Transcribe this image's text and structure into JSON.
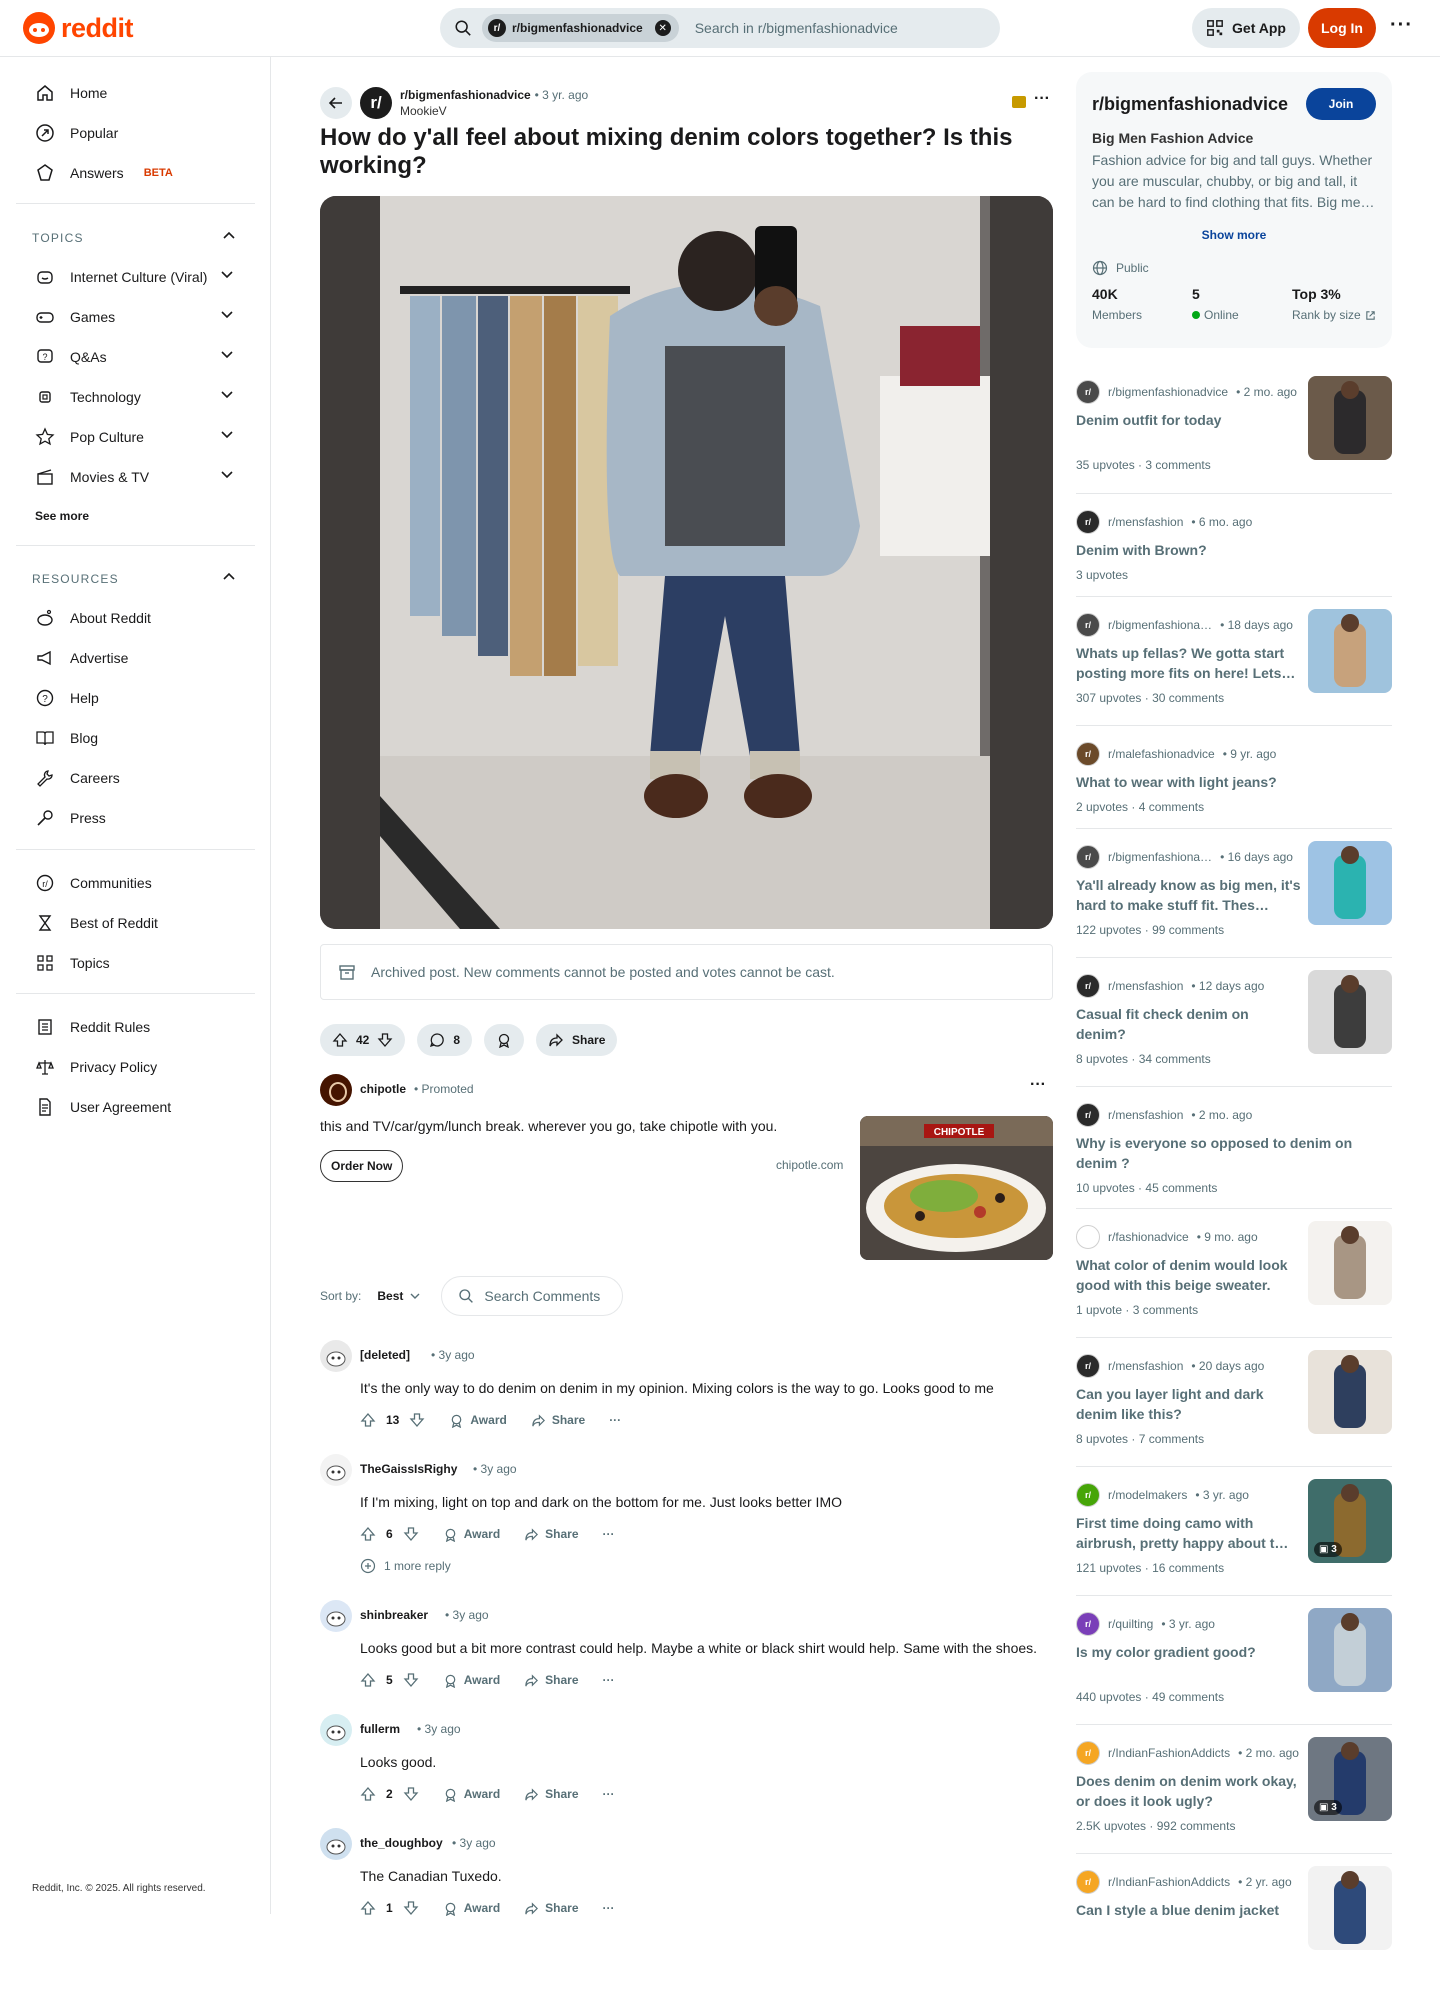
{
  "header": {
    "logo_text": "reddit",
    "search_chip": "r/bigmenfashionadvice",
    "search_placeholder": "Search in r/bigmenfashionadvice",
    "get_app": "Get App",
    "login": "Log In",
    "menu_icon": "more-dots-icon"
  },
  "leftnav": {
    "top": [
      {
        "label": "Home",
        "icon": "home-icon"
      },
      {
        "label": "Popular",
        "icon": "popular-icon"
      },
      {
        "label": "Answers",
        "icon": "answers-icon",
        "badge": "BETA"
      }
    ],
    "topics_title": "TOPICS",
    "topics": [
      {
        "label": "Internet Culture (Viral)",
        "icon": "smile-icon"
      },
      {
        "label": "Games",
        "icon": "gamepad-icon"
      },
      {
        "label": "Q&As",
        "icon": "question-bubble-icon"
      },
      {
        "label": "Technology",
        "icon": "chip-icon"
      },
      {
        "label": "Pop Culture",
        "icon": "star-icon"
      },
      {
        "label": "Movies & TV",
        "icon": "clapper-icon"
      }
    ],
    "see_more": "See more",
    "resources_title": "RESOURCES",
    "resources": [
      {
        "label": "About Reddit",
        "icon": "reddit-icon"
      },
      {
        "label": "Advertise",
        "icon": "megaphone-icon"
      },
      {
        "label": "Help",
        "icon": "help-icon"
      },
      {
        "label": "Blog",
        "icon": "book-icon"
      },
      {
        "label": "Careers",
        "icon": "wrench-icon"
      },
      {
        "label": "Press",
        "icon": "mic-icon"
      }
    ],
    "more": [
      {
        "label": "Communities",
        "icon": "communities-icon"
      },
      {
        "label": "Best of Reddit",
        "icon": "hourglass-icon"
      },
      {
        "label": "Topics",
        "icon": "grid-icon"
      }
    ],
    "legal": [
      {
        "label": "Reddit Rules",
        "icon": "rules-icon"
      },
      {
        "label": "Privacy Policy",
        "icon": "scales-icon"
      },
      {
        "label": "User Agreement",
        "icon": "document-icon"
      }
    ],
    "copyright": "Reddit, Inc. © 2025. All rights reserved."
  },
  "post": {
    "subreddit": "r/bigmenfashionadvice",
    "time": "• 3 yr. ago",
    "author": "MookieV",
    "title": "How do y'all feel about mixing denim colors together? Is this working?",
    "archived_notice": "Archived post. New comments cannot be posted and votes cannot be cast.",
    "votes": "42",
    "comments": "8",
    "share": "Share"
  },
  "ad": {
    "name": "chipotle",
    "promoted": "Promoted",
    "text": "this and TV/car/gym/lunch break. wherever you go, take chipotle with you.",
    "cta": "Order Now",
    "domain": "chipotle.com",
    "image_label": "CHIPOTLE"
  },
  "sort": {
    "label": "Sort by:",
    "value": "Best",
    "search_placeholder": "Search Comments"
  },
  "comments": [
    {
      "author": "[deleted]",
      "time": "• 3y ago",
      "body": "It's the only way to do denim on denim in my opinion. Mixing colors is the way to go. Looks good to me",
      "votes": "13",
      "award": "Award",
      "share": "Share"
    },
    {
      "author": "TheGaissIsRighy",
      "time": "• 3y ago",
      "body": "If I'm mixing, light on top and dark on the bottom for me. Just looks better IMO",
      "votes": "6",
      "award": "Award",
      "share": "Share",
      "more_replies": "1 more reply"
    },
    {
      "author": "shinbreaker",
      "time": "• 3y ago",
      "body": "Looks good but a bit more contrast could help. Maybe a white or black shirt would help. Same with the shoes.",
      "votes": "5",
      "award": "Award",
      "share": "Share"
    },
    {
      "author": "fullerm",
      "time": "• 3y ago",
      "body": "Looks good.",
      "votes": "2",
      "award": "Award",
      "share": "Share"
    },
    {
      "author": "the_doughboy",
      "time": "• 3y ago",
      "body": "The Canadian Tuxedo.",
      "votes": "1",
      "award": "Award",
      "share": "Share"
    }
  ],
  "sidebar": {
    "title": "r/bigmenfashionadvice",
    "join": "Join",
    "subtitle": "Big Men Fashion Advice",
    "description": "Fashion advice for big and tall guys. Whether you are muscular, chubby, or big and tall, it can be hard to find clothing that fits. Big me…",
    "show_more": "Show more",
    "visibility": "Public",
    "members_value": "40K",
    "members_label": "Members",
    "online_value": "5",
    "online_label": "Online",
    "rank_value": "Top 3%",
    "rank_label": "Rank by size"
  },
  "related": [
    {
      "sub": "r/bigmenfashionadvice",
      "time": "• 2 mo. ago",
      "title": "Denim outfit for today",
      "upvotes": "35 upvotes",
      "comments": "3 comments",
      "avatar_color": "#4a4a4a"
    },
    {
      "sub": "r/mensfashion",
      "time": "• 6 mo. ago",
      "title": "Denim with Brown?",
      "upvotes": "3 upvotes",
      "comments": "",
      "avatar_color": "#2a2a2a"
    },
    {
      "sub": "r/bigmenfashiona…",
      "time": "• 18 days ago",
      "title": "Whats up fellas? We gotta start posting more fits on here! Lets…",
      "upvotes": "307 upvotes",
      "comments": "30 comments",
      "avatar_color": "#4a4a4a"
    },
    {
      "sub": "r/malefashionadvice",
      "time": "• 9 yr. ago",
      "title": "What to wear with light jeans?",
      "upvotes": "2 upvotes",
      "comments": "4 comments",
      "avatar_color": "#6b4a2a"
    },
    {
      "sub": "r/bigmenfashiona…",
      "time": "• 16 days ago",
      "title": "Ya'll already know as big men, it's hard to make stuff fit. Thes…",
      "upvotes": "122 upvotes",
      "comments": "99 comments",
      "avatar_color": "#4a4a4a"
    },
    {
      "sub": "r/mensfashion",
      "time": "• 12 days ago",
      "title": "Casual fit check denim on denim?",
      "upvotes": "8 upvotes",
      "comments": "34 comments",
      "avatar_color": "#2a2a2a"
    },
    {
      "sub": "r/mensfashion",
      "time": "• 2 mo. ago",
      "title": "Why is everyone so opposed to denim on denim ?",
      "upvotes": "10 upvotes",
      "comments": "45 comments",
      "avatar_color": "#2a2a2a"
    },
    {
      "sub": "r/fashionadvice",
      "time": "• 9 mo. ago",
      "title": "What color of denim would look good with this beige sweater.",
      "upvotes": "1 upvote",
      "comments": "3 comments",
      "avatar_color": "#ffffff"
    },
    {
      "sub": "r/mensfashion",
      "time": "• 20 days ago",
      "title": "Can you layer light and dark denim like this?",
      "upvotes": "8 upvotes",
      "comments": "7 comments",
      "avatar_color": "#2a2a2a"
    },
    {
      "sub": "r/modelmakers",
      "time": "• 3 yr. ago",
      "title": "First time doing camo with airbrush, pretty happy about t…",
      "upvotes": "121 upvotes",
      "comments": "16 comments",
      "avatar_color": "#46a508",
      "gallery": "3"
    },
    {
      "sub": "r/quilting",
      "time": "• 3 yr. ago",
      "title": "Is my color gradient good?",
      "upvotes": "440 upvotes",
      "comments": "49 comments",
      "avatar_color": "#7a3fb8"
    },
    {
      "sub": "r/IndianFashionAddicts",
      "time": "• 2 mo. ago",
      "title": "Does denim on denim work okay, or does it look ugly?",
      "upvotes": "2.5K upvotes",
      "comments": "992 comments",
      "avatar_color": "#f5a623",
      "gallery": "3"
    },
    {
      "sub": "r/IndianFashionAddicts",
      "time": "• 2 yr. ago",
      "title": "Can I style a blue denim jacket",
      "upvotes": "",
      "comments": "",
      "avatar_color": "#f5a623"
    }
  ]
}
